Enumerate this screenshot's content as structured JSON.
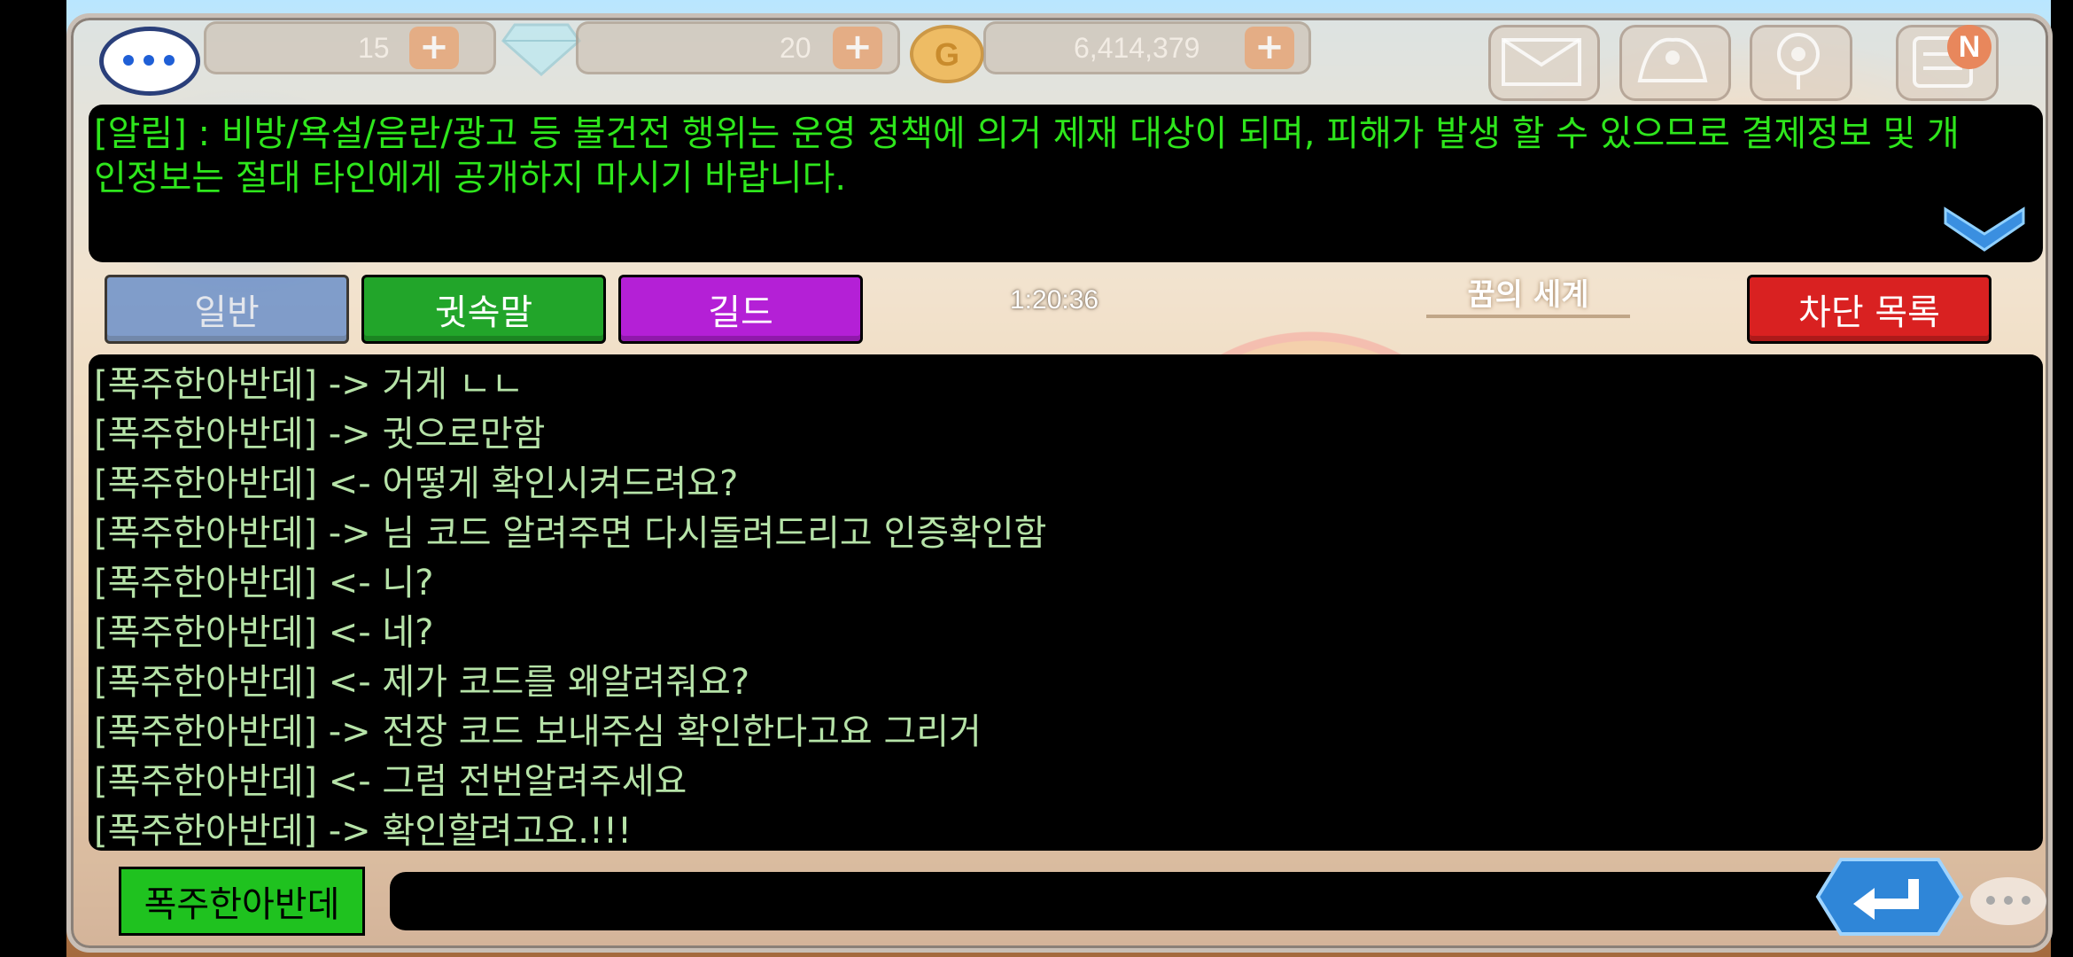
{
  "hud": {
    "energy": "15",
    "gems": "20",
    "gold": "6,414,379",
    "notification_badge": "N"
  },
  "notice": {
    "text": "[알림] : 비방/욕설/음란/광고 등 불건전 행위는 운영 정책에 의거 제재 대상이 되며, 피해가 발생 할 수 있으므로 결제정보 및 개인정보는 절대 타인에게 공개하지 마시기 바랍니다."
  },
  "tabs": {
    "general": "일반",
    "whisper": "귓속말",
    "guild": "길드",
    "block_list": "차단 목록"
  },
  "clock": "1:20:36",
  "world_name": "꿈의 세계",
  "chat": {
    "messages": [
      "[폭주한아반데] -> 거게 ㄴㄴ",
      "[폭주한아반데] -> 귓으로만함",
      "[폭주한아반데] <- 어떻게 확인시켜드려요?",
      "[폭주한아반데] -> 님 코드 알려주면 다시돌려드리고 인증확인함",
      "[폭주한아반데] <- 니?",
      "[폭주한아반데] <- 네?",
      "[폭주한아반데] <- 제가 코드를 왜알려줘요?",
      "[폭주한아반데] -> 전장 코드 보내주심 확인한다고요 그리거",
      "[폭주한아반데] <- 그럼 전번알려주세요",
      "[폭주한아반데] -> 확인할려고요.!!!"
    ]
  },
  "input": {
    "recipient": "폭주한아반데",
    "value": ""
  },
  "colors": {
    "notice_text": "#2ee61c",
    "chat_text": "#b6e3a8",
    "tab_general": "#5b86c9",
    "tab_whisper": "#22a52a",
    "tab_guild": "#b420d6",
    "block_button": "#d92121",
    "recipient_button": "#1fc21f"
  },
  "icons": [
    "chat-bubble-icon",
    "diamond-icon",
    "gold-coin-icon",
    "mail-icon",
    "shop-icon",
    "location-pin-icon",
    "notice-board-icon",
    "chevron-down-icon",
    "enter-icon"
  ]
}
